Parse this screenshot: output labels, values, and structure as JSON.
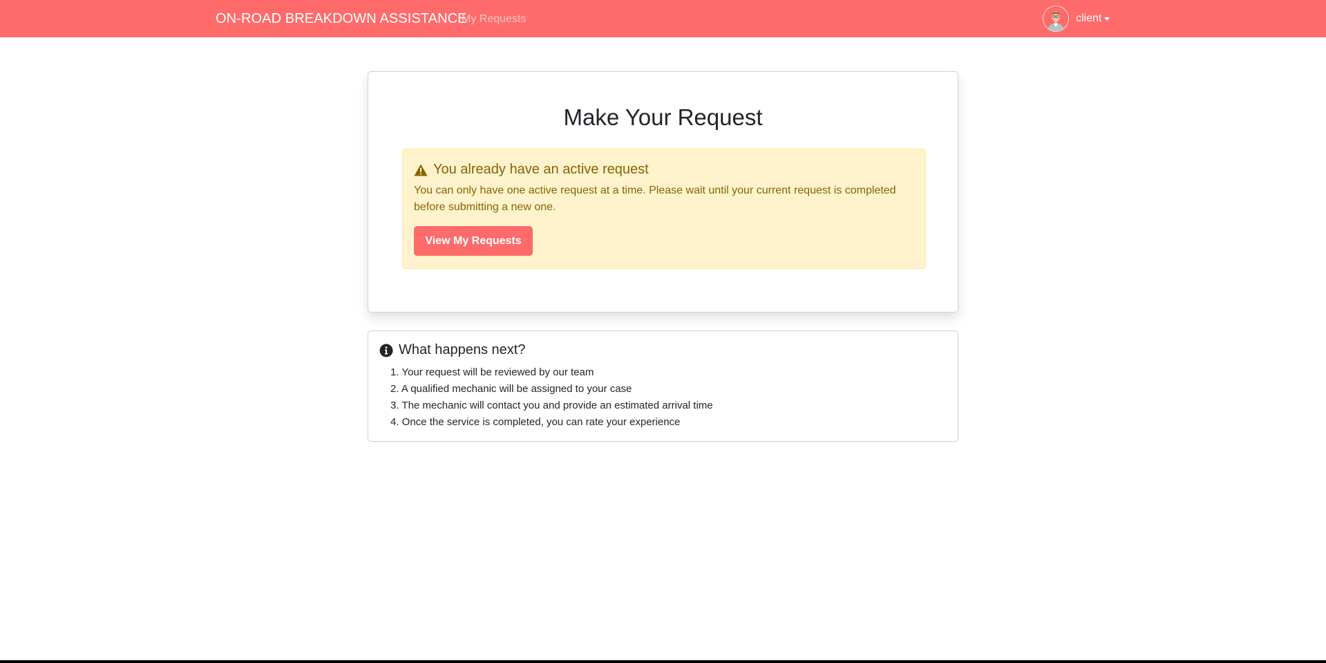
{
  "navbar": {
    "brand": "ON-ROAD BREAKDOWN ASSISTANCE",
    "links": [
      {
        "label": "My Requests"
      }
    ],
    "user": {
      "name": "client",
      "avatar_icon": "user-avatar-icon"
    }
  },
  "request_card": {
    "title": "Make Your Request",
    "alert": {
      "icon": "warning-triangle-icon",
      "title": "You already have an active request",
      "message": "You can only have one active request at a time. Please wait until your current request is completed before submitting a new one.",
      "button_label": "View My Requests"
    }
  },
  "info_card": {
    "icon": "info-circle-icon",
    "title": "What happens next?",
    "steps": [
      "1. Your request will be reviewed by our team",
      "2. A qualified mechanic will be assigned to your case",
      "3. The mechanic will contact you and provide an estimated arrival time",
      "4. Once the service is completed, you can rate your experience"
    ]
  },
  "colors": {
    "accent": "#ff6b6b",
    "alert_bg": "#fff3cd",
    "alert_text": "#856404"
  }
}
